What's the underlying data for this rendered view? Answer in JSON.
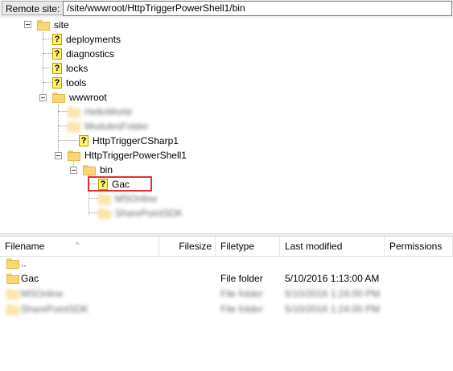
{
  "address_bar": {
    "label": "Remote site:",
    "path": "/site/wwwroot/HttpTriggerPowerShell1/bin"
  },
  "tree": {
    "site": "site",
    "children": [
      "deployments",
      "diagnostics",
      "locks",
      "tools"
    ],
    "wwwroot": "wwwroot",
    "blurred_1": "HelloWorld",
    "blurred_2": "ModulesFolder",
    "http_csharp": "HttpTriggerCSharp1",
    "http_ps": "HttpTriggerPowerShell1",
    "bin": "bin",
    "gac": "Gac",
    "blurred_3": "MSOnline",
    "blurred_4": "SharePointSDK"
  },
  "file_list": {
    "columns": {
      "filename": "Filename",
      "filesize": "Filesize",
      "filetype": "Filetype",
      "last_modified": "Last modified",
      "permissions": "Permissions"
    },
    "rows": [
      {
        "name": "..",
        "type": "",
        "modified": ""
      },
      {
        "name": "Gac",
        "type": "File folder",
        "modified": "5/10/2016 1:13:00 AM"
      },
      {
        "name": "MSOnline",
        "type": "File folder",
        "modified": "5/10/2016 1:24:00 PM"
      },
      {
        "name": "SharePointSDK",
        "type": "File folder",
        "modified": "5/10/2016 1:24:00 PM"
      }
    ]
  },
  "colors": {
    "highlight": "#e03030",
    "folder": "#f8d775",
    "unknown_icon": "#fff36a"
  }
}
